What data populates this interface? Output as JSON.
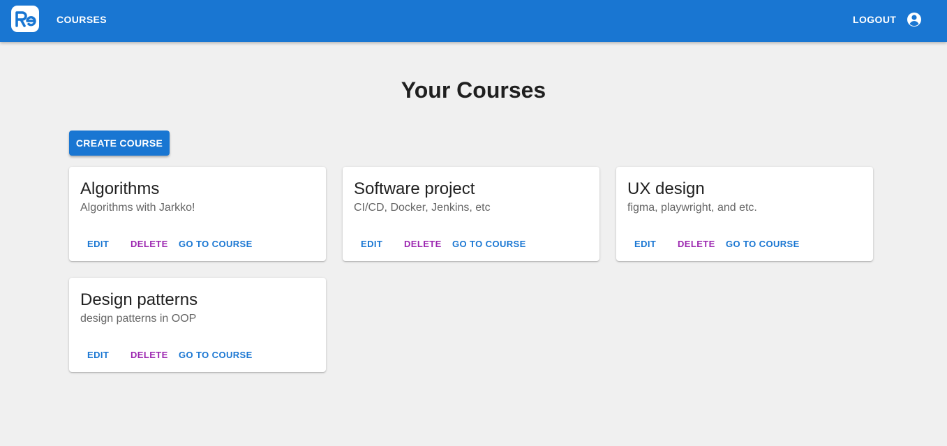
{
  "appbar": {
    "logo_text": "Re",
    "nav_courses": "COURSES",
    "logout": "LOGOUT",
    "account_icon": "account-circle-icon",
    "color": "#1976d2"
  },
  "page": {
    "title": "Your Courses",
    "create_button": "CREATE COURSE"
  },
  "actions": {
    "edit": "EDIT",
    "delete": "DELETE",
    "go": "GO TO COURSE"
  },
  "colors": {
    "primary": "#1976d2",
    "secondary": "#9c27b0",
    "background": "#f0f0f0"
  },
  "courses": [
    {
      "title": "Algorithms",
      "description": "Algorithms with Jarkko!"
    },
    {
      "title": "Software project",
      "description": "CI/CD, Docker, Jenkins, etc"
    },
    {
      "title": "UX design",
      "description": "figma, playwright, and etc."
    },
    {
      "title": "Design patterns",
      "description": "design patterns in OOP"
    }
  ]
}
